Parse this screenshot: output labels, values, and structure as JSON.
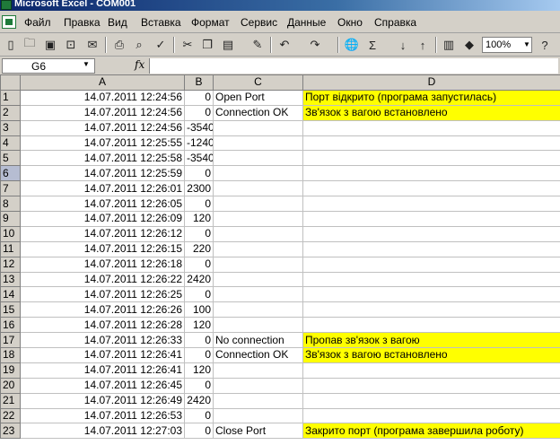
{
  "window": {
    "title": "Microsoft Excel - COM001"
  },
  "menu": [
    "Файл",
    "Правка",
    "Вид",
    "Вставка",
    "Формат",
    "Сервис",
    "Данные",
    "Окно",
    "Справка"
  ],
  "toolbar": {
    "zoom": "100%"
  },
  "formula_bar": {
    "name_box": "G6",
    "fx_label": "fx",
    "content": ""
  },
  "columns": [
    "A",
    "B",
    "C",
    "D"
  ],
  "selected_row": 6,
  "rows": [
    {
      "n": "1",
      "a": "14.07.2011 12:24:56",
      "b": "0",
      "c": "Open Port",
      "d": "Порт відкрито (програма запустилась)"
    },
    {
      "n": "2",
      "a": "14.07.2011 12:24:56",
      "b": "0",
      "c": "Connection OK",
      "d": "Зв'язок з вагою встановлено"
    },
    {
      "n": "3",
      "a": "14.07.2011 12:24:56",
      "b": "-3540",
      "c": "",
      "d": ""
    },
    {
      "n": "4",
      "a": "14.07.2011 12:25:55",
      "b": "-1240",
      "c": "",
      "d": ""
    },
    {
      "n": "5",
      "a": "14.07.2011 12:25:58",
      "b": "-3540",
      "c": "",
      "d": ""
    },
    {
      "n": "6",
      "a": "14.07.2011 12:25:59",
      "b": "0",
      "c": "",
      "d": ""
    },
    {
      "n": "7",
      "a": "14.07.2011 12:26:01",
      "b": "2300",
      "c": "",
      "d": ""
    },
    {
      "n": "8",
      "a": "14.07.2011 12:26:05",
      "b": "0",
      "c": "",
      "d": ""
    },
    {
      "n": "9",
      "a": "14.07.2011 12:26:09",
      "b": "120",
      "c": "",
      "d": ""
    },
    {
      "n": "10",
      "a": "14.07.2011 12:26:12",
      "b": "0",
      "c": "",
      "d": ""
    },
    {
      "n": "11",
      "a": "14.07.2011 12:26:15",
      "b": "220",
      "c": "",
      "d": ""
    },
    {
      "n": "12",
      "a": "14.07.2011 12:26:18",
      "b": "0",
      "c": "",
      "d": ""
    },
    {
      "n": "13",
      "a": "14.07.2011 12:26:22",
      "b": "2420",
      "c": "",
      "d": ""
    },
    {
      "n": "14",
      "a": "14.07.2011 12:26:25",
      "b": "0",
      "c": "",
      "d": ""
    },
    {
      "n": "15",
      "a": "14.07.2011 12:26:26",
      "b": "100",
      "c": "",
      "d": ""
    },
    {
      "n": "16",
      "a": "14.07.2011 12:26:28",
      "b": "120",
      "c": "",
      "d": ""
    },
    {
      "n": "17",
      "a": "14.07.2011 12:26:33",
      "b": "0",
      "c": "No connection",
      "d": "Пропав зв'язок з вагою"
    },
    {
      "n": "18",
      "a": "14.07.2011 12:26:41",
      "b": "0",
      "c": "Connection OK",
      "d": "Зв'язок з вагою встановлено"
    },
    {
      "n": "19",
      "a": "14.07.2011 12:26:41",
      "b": "120",
      "c": "",
      "d": ""
    },
    {
      "n": "20",
      "a": "14.07.2011 12:26:45",
      "b": "0",
      "c": "",
      "d": ""
    },
    {
      "n": "21",
      "a": "14.07.2011 12:26:49",
      "b": "2420",
      "c": "",
      "d": ""
    },
    {
      "n": "22",
      "a": "14.07.2011 12:26:53",
      "b": "0",
      "c": "",
      "d": ""
    },
    {
      "n": "23",
      "a": "14.07.2011 12:27:03",
      "b": "0",
      "c": "Close Port",
      "d": "Закрито порт (програма завершила роботу)"
    }
  ],
  "colors": {
    "highlight": "#ffff00",
    "chrome": "#d4d0c8"
  }
}
